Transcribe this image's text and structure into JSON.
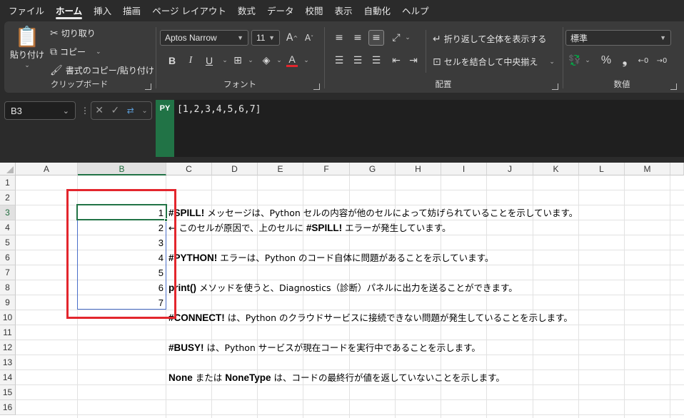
{
  "menu": {
    "items": [
      "ファイル",
      "ホーム",
      "挿入",
      "描画",
      "ページ レイアウト",
      "数式",
      "データ",
      "校閲",
      "表示",
      "自動化",
      "ヘルプ"
    ],
    "active": "ホーム"
  },
  "ribbon": {
    "clipboard": {
      "label": "クリップボード",
      "paste": "貼り付け",
      "cut": "切り取り",
      "copy": "コピー",
      "format_painter": "書式のコピー/貼り付け"
    },
    "font": {
      "label": "フォント",
      "font_name": "Aptos Narrow",
      "font_size": "11",
      "bold": "B",
      "italic": "I",
      "underline": "U",
      "font_color": "#e3262d"
    },
    "alignment": {
      "label": "配置",
      "wrap_text": "折り返して全体を表示する",
      "merge_center": "セルを結合して中央揃え"
    },
    "number": {
      "label": "数値",
      "format": "標準"
    }
  },
  "formula_bar": {
    "name_box": "B3",
    "python_badge": "PY",
    "content": "[1,2,3,4,5,6,7]"
  },
  "sheet": {
    "columns": [
      "A",
      "B",
      "C",
      "D",
      "E",
      "F",
      "G",
      "H",
      "I",
      "J",
      "K",
      "L",
      "M"
    ],
    "rows": [
      "1",
      "2",
      "3",
      "4",
      "5",
      "6",
      "7",
      "8",
      "9",
      "10",
      "11",
      "12",
      "13",
      "14",
      "15",
      "16"
    ],
    "selected_column": "B",
    "selected_row": "3",
    "spill_values": [
      "1",
      "2",
      "3",
      "4",
      "5",
      "6",
      "7"
    ],
    "notes": [
      {
        "bold": "#SPILL!",
        "text": " メッセージは、Python セルの内容が他のセルによって妨げられていることを示しています。"
      },
      {
        "bold": "#SPILL!",
        "prefix": "← このセルが原因で、上のセルに ",
        "text": " エラーが発生しています。"
      },
      {
        "bold": "#PYTHON!",
        "text": " エラーは、Python のコード自体に問題があることを示しています。"
      },
      {
        "bold": "print()",
        "text": " メソッドを使うと、Diagnostics（診断）パネルに出力を送ることができます。"
      },
      {
        "bold": "#CONNECT!",
        "text": " は、Python のクラウドサービスに接続できない問題が発生していることを示します。"
      },
      {
        "bold": "#BUSY!",
        "text": " は、Python サービスが現在コードを実行中であることを示します。"
      },
      {
        "bold": "None",
        "mid": " または ",
        "bold2": "NoneType",
        "text": " は、コードの最終行が値を返していないことを示します。"
      }
    ]
  },
  "colors": {
    "excel_green": "#217346",
    "highlight_red": "#e3262d",
    "spill_border": "#4a6fc9"
  }
}
